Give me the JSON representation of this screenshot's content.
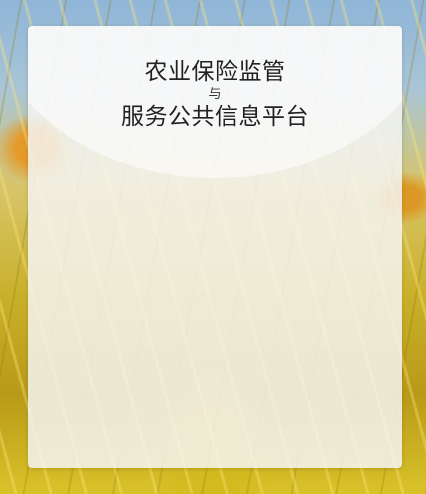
{
  "app": {
    "title_line1": "农业保险监管",
    "title_connector": "与",
    "title_line2": "服务公共信息平台"
  },
  "colors": {
    "panel_bg": "#f5f6f4",
    "title_text": "#222222",
    "background_theme": "golden rice field"
  }
}
